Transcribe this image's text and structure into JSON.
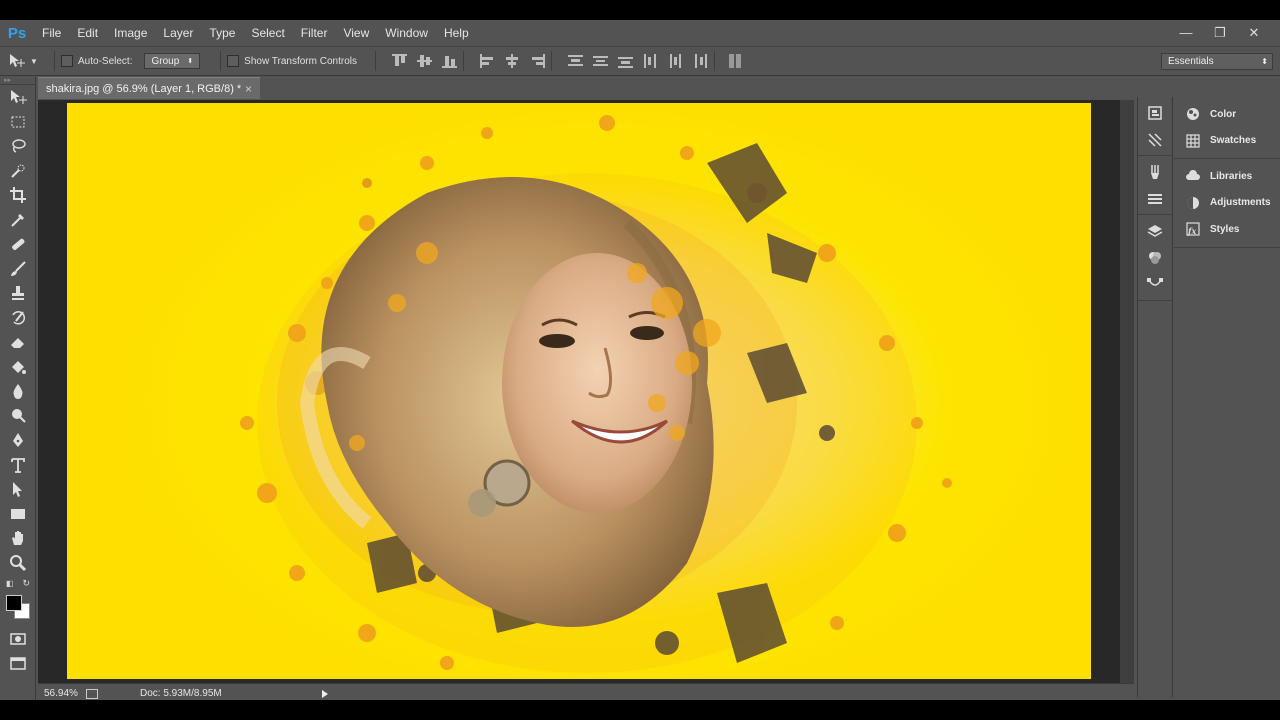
{
  "app": {
    "logo": "Ps"
  },
  "menu": [
    "File",
    "Edit",
    "Image",
    "Layer",
    "Type",
    "Select",
    "Filter",
    "View",
    "Window",
    "Help"
  ],
  "window_controls": {
    "minimize": "—",
    "restore": "❐",
    "close": "✕"
  },
  "options_bar": {
    "auto_select_label": "Auto-Select:",
    "auto_select_value": "Group",
    "show_transform_label": "Show Transform Controls",
    "workspace": "Essentials"
  },
  "document": {
    "tab_title": "shakira.jpg @ 56.9% (Layer 1, RGB/8) *",
    "close": "×",
    "zoom": "56.94%",
    "doc_size": "Doc: 5.93M/8.95M"
  },
  "tools": [
    "move-tool",
    "marquee-tool",
    "lasso-tool",
    "quick-selection-tool",
    "crop-tool",
    "eyedropper-tool",
    "healing-brush-tool",
    "brush-tool",
    "clone-stamp-tool",
    "history-brush-tool",
    "eraser-tool",
    "paint-bucket-tool",
    "blur-tool",
    "dodge-tool",
    "pen-tool",
    "type-tool",
    "path-selection-tool",
    "rectangle-tool",
    "hand-tool",
    "zoom-tool"
  ],
  "colors": {
    "foreground": "#000000",
    "background": "#ffffff",
    "canvas": "#fde500",
    "splatter": "#f2a81d",
    "ps_blue": "#2fa3f2"
  },
  "panels": [
    {
      "label": "Color",
      "icon": "color-wheel-icon"
    },
    {
      "label": "Swatches",
      "icon": "swatches-grid-icon"
    },
    {
      "label": "Libraries",
      "icon": "cloud-libraries-icon"
    },
    {
      "label": "Adjustments",
      "icon": "adjustments-circle-icon"
    },
    {
      "label": "Styles",
      "icon": "fx-styles-icon"
    }
  ]
}
